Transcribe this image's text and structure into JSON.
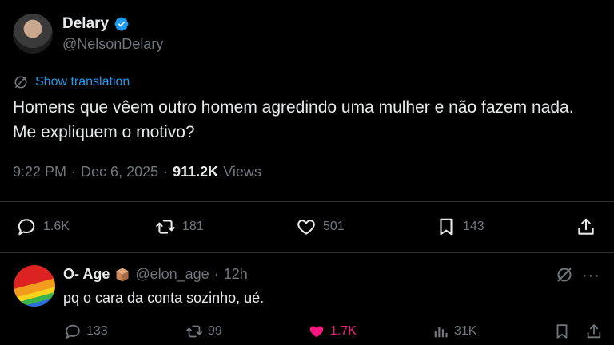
{
  "tweet": {
    "author_name": "Delary",
    "author_handle": "@NelsonDelary",
    "translate_label": "Show translation",
    "text": "Homens que vêem outro homem agredindo uma mulher e não fazem nada. Me expliquem o motivo?",
    "time": "9:22 PM",
    "sep1": "·",
    "date": "Dec 6, 2025",
    "sep2": "·",
    "views_count": "911.2K",
    "views_label": "Views",
    "stats": {
      "replies": "1.6K",
      "reposts": "181",
      "likes": "501",
      "bookmarks": "143"
    }
  },
  "reply": {
    "author_name": "O- Age",
    "author_handle": "@elon_age",
    "sep": "·",
    "age": "12h",
    "text": "pq o cara da conta sozinho, ué.",
    "more": "···",
    "stats": {
      "replies": "133",
      "reposts": "99",
      "likes": "1.7K",
      "views": "31K"
    }
  },
  "colors": {
    "background": "#000000",
    "text": "#e7e9ea",
    "muted": "#71767b",
    "accent_blue": "#1d9bf0",
    "like_pink": "#f91880",
    "divider": "#2f3336"
  },
  "icons": [
    "verified-badge-icon",
    "translate-icon",
    "reply-icon",
    "repost-icon",
    "like-icon",
    "bookmark-icon",
    "share-icon",
    "package-icon",
    "grok-icon",
    "views-icon",
    "more-icon"
  ]
}
